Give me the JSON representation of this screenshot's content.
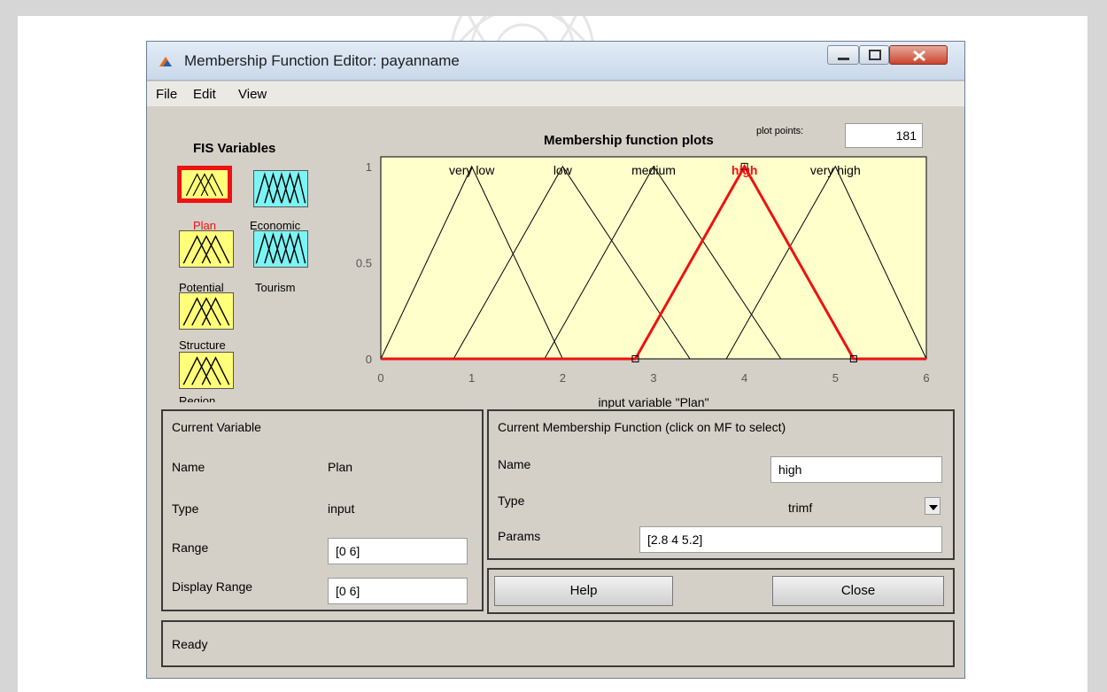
{
  "window": {
    "title": "Membership Function Editor: payanname"
  },
  "menu": [
    "File",
    "Edit",
    "View"
  ],
  "fis": {
    "heading": "FIS Variables",
    "variables": [
      "Plan",
      "Economic",
      "Potential",
      "Tourism",
      "Structure",
      "Region"
    ]
  },
  "plot": {
    "title": "Membership function plots",
    "points_label": "plot points:",
    "points_value": "181",
    "xlabel": "input variable \"Plan\""
  },
  "chart_data": {
    "type": "line",
    "title": "Membership function plots",
    "xlabel": "input variable \"Plan\"",
    "ylabel": "",
    "xlim": [
      0,
      6
    ],
    "ylim": [
      0,
      1.05
    ],
    "x_ticks": [
      "0",
      "1",
      "2",
      "3",
      "4",
      "5",
      "6"
    ],
    "y_ticks": [
      "0",
      "0.5",
      "1"
    ],
    "grid": false,
    "selected": "high",
    "colors": {
      "background": "#ffffcc",
      "line": "#000000",
      "selected": "#ee1111"
    },
    "series": [
      {
        "name": "very_low",
        "label": "very low",
        "values": [
          [
            0,
            0
          ],
          [
            1,
            1
          ],
          [
            2,
            0
          ]
        ]
      },
      {
        "name": "low",
        "label": "low",
        "values": [
          [
            0.8,
            0
          ],
          [
            2,
            1
          ],
          [
            3.4,
            0
          ]
        ]
      },
      {
        "name": "medium",
        "label": "medium",
        "values": [
          [
            1.8,
            0
          ],
          [
            3,
            1
          ],
          [
            4.4,
            0
          ]
        ]
      },
      {
        "name": "high",
        "label": "high",
        "values": [
          [
            2.8,
            0
          ],
          [
            4,
            1
          ],
          [
            5.2,
            0
          ]
        ]
      },
      {
        "name": "very_high",
        "label": "very high",
        "values": [
          [
            3.8,
            0
          ],
          [
            5,
            1
          ],
          [
            6,
            0
          ]
        ]
      }
    ]
  },
  "current_variable": {
    "title": "Current Variable",
    "name_label": "Name",
    "name_value": "Plan",
    "type_label": "Type",
    "type_value": "input",
    "range_label": "Range",
    "range_value": "[0 6]",
    "display_label": "Display Range",
    "display_value": "[0 6]"
  },
  "current_mf": {
    "title": "Current Membership Function (click on MF to select)",
    "name_label": "Name",
    "name_value": "high",
    "type_label": "Type",
    "type_value": "trimf",
    "params_label": "Params",
    "params_value": "[2.8 4 5.2]"
  },
  "buttons": {
    "help": "Help",
    "close": "Close"
  },
  "status": "Ready"
}
